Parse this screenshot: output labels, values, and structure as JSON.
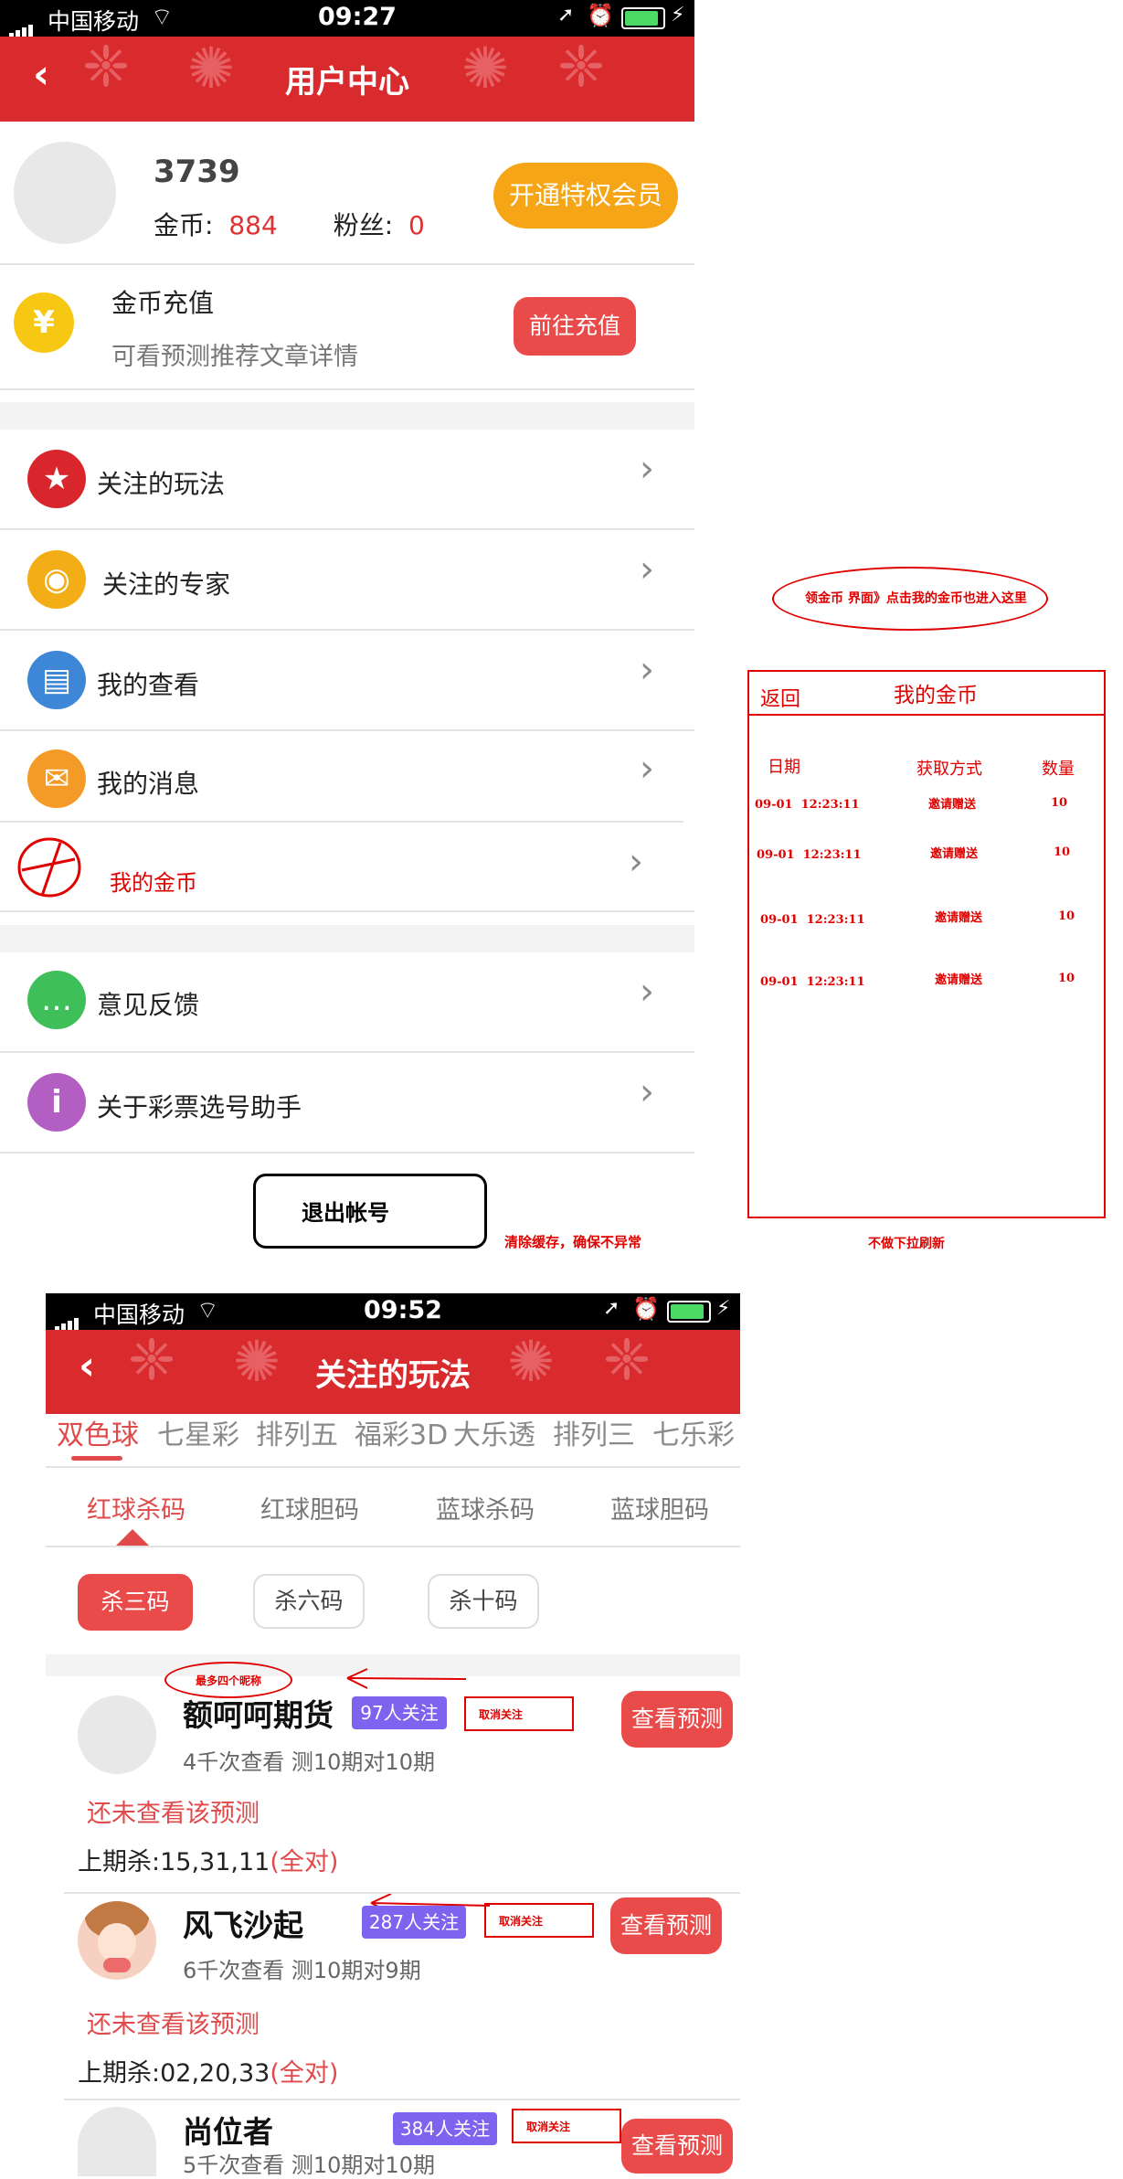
{
  "screen1": {
    "status": {
      "carrier": "中国移动",
      "time": "09:27"
    },
    "header": {
      "title": "用户中心"
    },
    "profile": {
      "username": "3739",
      "coins_label": "金币:",
      "coins_value": "884",
      "fans_label": "粉丝:",
      "fans_value": "0",
      "vip_button": "开通特权会员"
    },
    "recharge": {
      "title": "金币充值",
      "subtitle": "可看预测推荐文章详情",
      "button": "前往充值",
      "icon_symbol": "¥"
    },
    "menu": [
      {
        "label": "关注的玩法",
        "icon": "star-icon",
        "color": "#d9262c"
      },
      {
        "label": "关注的专家",
        "icon": "eye-icon",
        "color": "#f3ae17"
      },
      {
        "label": "我的查看",
        "icon": "document-search-icon",
        "color": "#3e86d6"
      },
      {
        "label": "我的消息",
        "icon": "envelope-icon",
        "color": "#f49b27"
      },
      {
        "label": "我的金币",
        "icon": "hand-drawn-icon",
        "color": "#e00000"
      },
      {
        "label": "意见反馈",
        "icon": "chat-bubble-icon",
        "color": "#3fbf5a"
      },
      {
        "label": "关于彩票选号助手",
        "icon": "info-icon",
        "color": "#b35ec2"
      }
    ],
    "logout_button": "退出帐号"
  },
  "annotations": {
    "ellipse_note": "领金币 界面》点击我的金币也进入这里",
    "logout_note": "清除缓存，确保不异常",
    "coin_note": "不做下拉刷新",
    "nickname_note": "最多四个昵称",
    "unfollow_label": "取消关注"
  },
  "coin_panel": {
    "back": "返回",
    "title": "我的金币",
    "columns": [
      "日期",
      "获取方式",
      "数量"
    ],
    "rows": [
      {
        "date": "09-01  12:23:11",
        "method": "邀请赠送",
        "amount": "10"
      },
      {
        "date": "09-01  12:23:11",
        "method": "邀请赠送",
        "amount": "10"
      },
      {
        "date": "09-01  12:23:11",
        "method": "邀请赠送",
        "amount": "10"
      },
      {
        "date": "09-01  12:23:11",
        "method": "邀请赠送",
        "amount": "10"
      }
    ]
  },
  "screen2": {
    "status": {
      "carrier": "中国移动",
      "time": "09:52"
    },
    "header": {
      "title": "关注的玩法"
    },
    "lottery_tabs": [
      "双色球",
      "七星彩",
      "排列五",
      "福彩3D",
      "大乐透",
      "排列三",
      "七乐彩"
    ],
    "sub_tabs": [
      "红球杀码",
      "红球胆码",
      "蓝球杀码",
      "蓝球胆码"
    ],
    "chips": [
      "杀三码",
      "杀六码",
      "杀十码"
    ],
    "experts": [
      {
        "name": "额呵呵期货",
        "followers": "97人关注",
        "stats": "4千次查看 测10期对10期",
        "unread": "还未查看该预测",
        "last_kill_prefix": "上期杀:15,31,11",
        "last_kill_result": "(全对)",
        "button": "查看预测"
      },
      {
        "name": "风飞沙起",
        "followers": "287人关注",
        "stats": "6千次查看 测10期对9期",
        "unread": "还未查看该预测",
        "last_kill_prefix": "上期杀:02,20,33",
        "last_kill_result": "(全对)",
        "button": "查看预测"
      },
      {
        "name": "尚位者",
        "followers": "384人关注",
        "stats": "5千次查看 测10期对10期",
        "button": "查看预测"
      }
    ]
  }
}
